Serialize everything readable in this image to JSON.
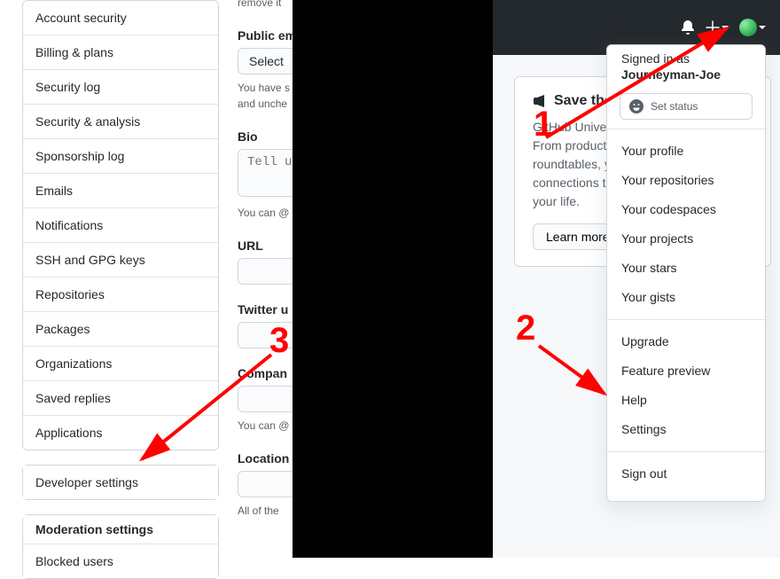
{
  "sidebar": {
    "items": [
      "Account security",
      "Billing & plans",
      "Security log",
      "Security & analysis",
      "Sponsorship log",
      "Emails",
      "Notifications",
      "SSH and GPG keys",
      "Repositories",
      "Packages",
      "Organizations",
      "Saved replies",
      "Applications"
    ],
    "developer": "Developer settings",
    "moderation_header": "Moderation settings",
    "moderation_items": [
      "Blocked users"
    ]
  },
  "form": {
    "remove_tail": "remove it",
    "public_email_label": "Public email",
    "public_email_select": "Select",
    "public_email_note1": "You have s",
    "public_email_note2": "and unche",
    "bio_label": "Bio",
    "bio_placeholder": "Tell us",
    "bio_note": "You can @",
    "url_label": "URL",
    "twitter_label": "Twitter u",
    "company_label": "Compan",
    "company_note": "You can @",
    "location_label": "Location",
    "location_note": "All of the"
  },
  "header": {
    "icons": {
      "bell": "notifications-icon",
      "plus": "new-icon",
      "avatar": "avatar-icon"
    }
  },
  "dropdown": {
    "signed_in_as": "Signed in as",
    "username": "Journeyman-Joe",
    "set_status": "Set status",
    "group1": [
      "Your profile",
      "Your repositories",
      "Your codespaces",
      "Your projects",
      "Your stars",
      "Your gists"
    ],
    "group2": [
      "Upgrade",
      "Feature preview",
      "Help",
      "Settings"
    ],
    "group3": [
      "Sign out"
    ]
  },
  "promo": {
    "title": "Save the",
    "body": "GitHub Universe\nFrom product de\nroundtables, you\nconnections to h\nyour life.",
    "button": "Learn more"
  },
  "annotations": {
    "n1": "1",
    "n2": "2",
    "n3": "3"
  }
}
